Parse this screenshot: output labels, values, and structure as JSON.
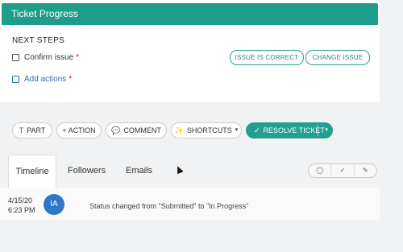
{
  "header": {
    "title": "Ticket Progress"
  },
  "next_steps": {
    "title": "NEXT STEPS",
    "confirm_label": "Confirm issue",
    "required_marker": "*",
    "add_actions_label": "Add actions",
    "issue_correct_label": "ISSUE IS CORRECT",
    "change_issue_label": "CHANGE ISSUE"
  },
  "toolbar": {
    "part_label": "PART",
    "action_label": "+ ACTION",
    "comment_label": "COMMENT",
    "shortcuts_label": "SHORTCUTS",
    "resolve_label": "RESOLVE TICKET",
    "part_icon": "T",
    "comment_icon": "💬",
    "shortcuts_icon": "✨",
    "caret": "▾",
    "check": "✓"
  },
  "tabs": [
    {
      "label": "Timeline"
    },
    {
      "label": "Followers"
    },
    {
      "label": "Emails"
    }
  ],
  "filter_icons": [
    "comment-icon",
    "check-icon",
    "edit-icon"
  ],
  "timeline": {
    "date": "4/15/20",
    "time": "6:23 PM",
    "avatar_initials": "IA",
    "status": "Status changed from \"Submitted\" to \"In Progress\""
  },
  "colors": {
    "accent": "#1f9d8b",
    "avatar": "#2e79c7",
    "required": "#dd1122"
  }
}
